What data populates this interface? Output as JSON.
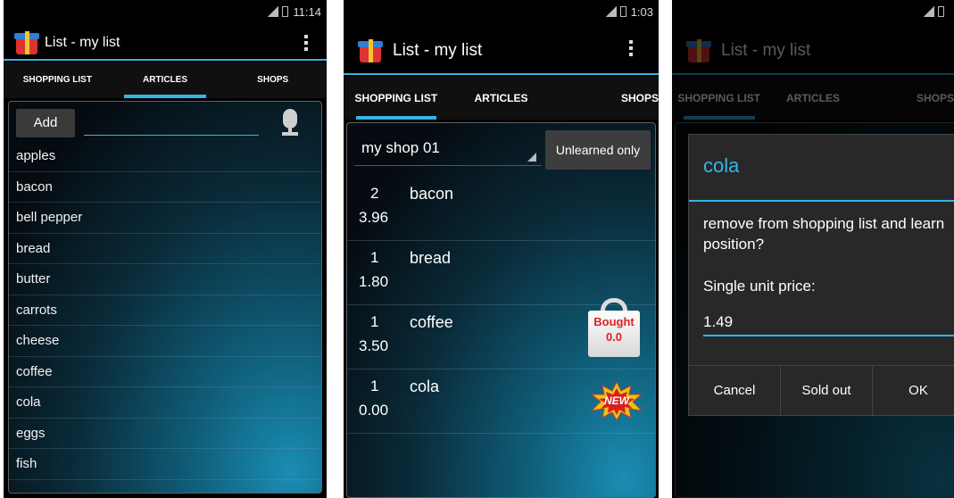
{
  "accent_color": "#33b5e5",
  "screen1": {
    "status": {
      "time": "11:14"
    },
    "app_title": "List - my list",
    "tabs": [
      "SHOPPING LIST",
      "ARTICLES",
      "SHOPS"
    ],
    "selected_tab": "ARTICLES",
    "add_button": "Add",
    "articles": [
      "apples",
      "bacon",
      "bell pepper",
      "bread",
      "butter",
      "carrots",
      "cheese",
      "coffee",
      "cola",
      "eggs",
      "fish"
    ]
  },
  "screen2": {
    "status": {
      "time": "1:03"
    },
    "app_title": "List - my list",
    "tabs": [
      "SHOPPING LIST",
      "ARTICLES",
      "SHOPS"
    ],
    "selected_tab": "SHOPPING LIST",
    "shop_selector": "my shop 01",
    "filter_button": "Unlearned only",
    "items": [
      {
        "qty": "2",
        "name": "bacon",
        "price": "3.96"
      },
      {
        "qty": "1",
        "name": "bread",
        "price": "1.80"
      },
      {
        "qty": "1",
        "name": "coffee",
        "price": "3.50"
      },
      {
        "qty": "1",
        "name": "cola",
        "price": "0.00"
      }
    ],
    "bought_badge": {
      "label": "Bought",
      "amount": "0.0"
    },
    "new_badge": "NEW"
  },
  "screen3": {
    "app_title": "List - my list",
    "tabs": [
      "SHOPPING LIST",
      "ARTICLES",
      "SHOPS"
    ],
    "dialog": {
      "title": "cola",
      "message": "remove from shopping list and learn position?",
      "price_label": "Single unit price:",
      "price_value": "1.49",
      "buttons": [
        "Cancel",
        "Sold out",
        "OK"
      ]
    }
  }
}
